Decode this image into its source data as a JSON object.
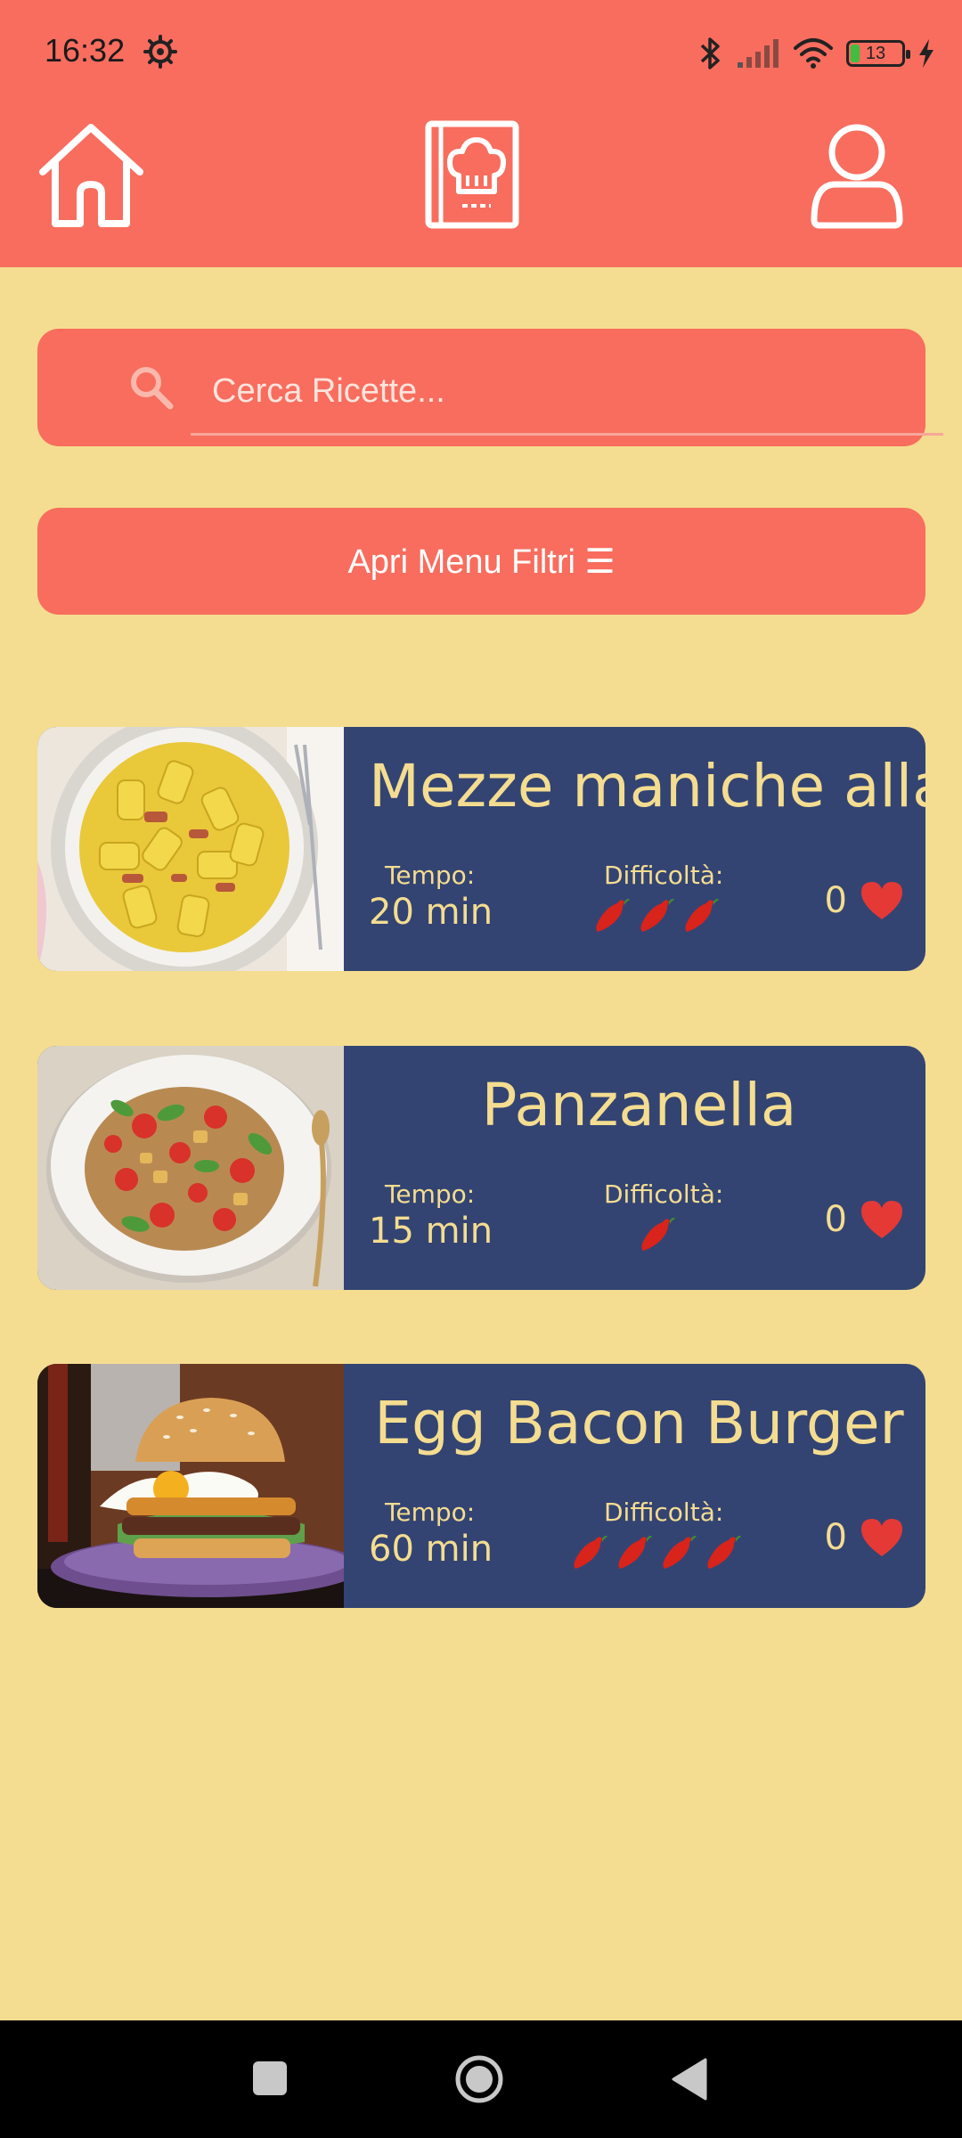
{
  "status": {
    "time": "16:32",
    "battery": "13"
  },
  "search": {
    "placeholder": "Cerca Ricette..."
  },
  "filters": {
    "button_label": "Apri Menu Filtri ☰"
  },
  "recipes": [
    {
      "title": "Mezze maniche alla",
      "time_label": "Tempo:",
      "time": "20 min",
      "difficulty_label": "Difficoltà:",
      "difficulty": 3,
      "likes": "0"
    },
    {
      "title": "Panzanella",
      "time_label": "Tempo:",
      "time": "15 min",
      "difficulty_label": "Difficoltà:",
      "difficulty": 1,
      "likes": "0"
    },
    {
      "title": "Egg Bacon Burger",
      "time_label": "Tempo:",
      "time": "60 min",
      "difficulty_label": "Difficoltà:",
      "difficulty": 4,
      "likes": "0"
    }
  ],
  "colors": {
    "header": "#F86D5E",
    "background": "#F4DD90",
    "card": "#334473",
    "card_text": "#F4DD90"
  }
}
